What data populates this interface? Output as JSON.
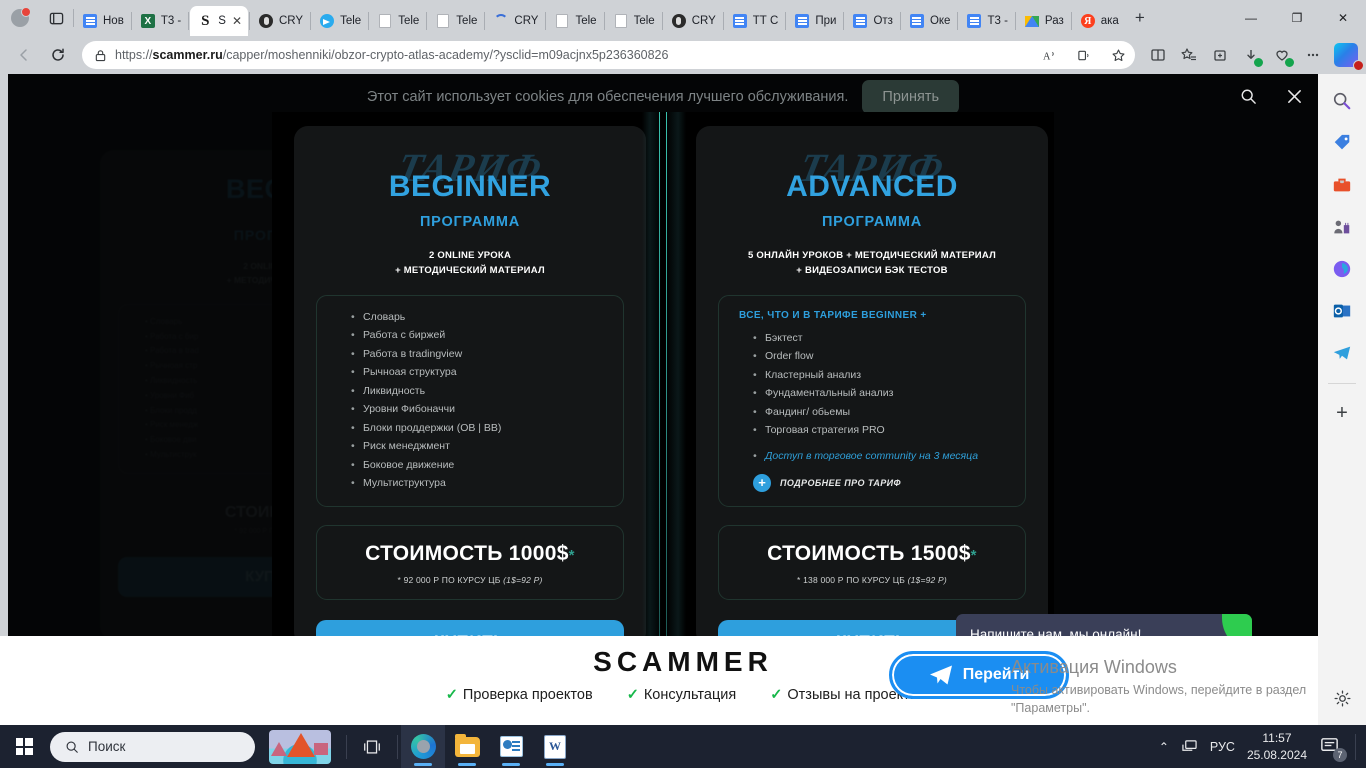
{
  "browser": {
    "tabs": [
      {
        "label": "Нов",
        "icon": "google-docs-icon",
        "active": false
      },
      {
        "label": "Т3 -",
        "icon": "excel-icon",
        "active": false
      },
      {
        "label": "S",
        "icon": "scammer-icon",
        "active": true
      },
      {
        "label": "CRY",
        "icon": "crypto-icon",
        "active": false
      },
      {
        "label": "Tele",
        "icon": "telegram-icon",
        "active": false
      },
      {
        "label": "Tele",
        "icon": "document-icon",
        "active": false
      },
      {
        "label": "Tele",
        "icon": "document-icon",
        "active": false
      },
      {
        "label": "CRY",
        "icon": "loading-spinner-icon",
        "active": false
      },
      {
        "label": "Tele",
        "icon": "document-icon",
        "active": false
      },
      {
        "label": "Tele",
        "icon": "document-icon",
        "active": false
      },
      {
        "label": "CRY",
        "icon": "crypto-icon",
        "active": false
      },
      {
        "label": "ТТ С",
        "icon": "google-docs-icon",
        "active": false
      },
      {
        "label": "При",
        "icon": "google-docs-icon",
        "active": false
      },
      {
        "label": "Отз",
        "icon": "google-docs-icon",
        "active": false
      },
      {
        "label": "Оке",
        "icon": "google-docs-icon",
        "active": false
      },
      {
        "label": "Т3 -",
        "icon": "google-docs-icon",
        "active": false
      },
      {
        "label": "Раз",
        "icon": "google-drive-icon",
        "active": false
      },
      {
        "label": "ака",
        "icon": "yandex-icon",
        "active": false
      }
    ],
    "new_tab_label": "+",
    "window_controls": {
      "minimize": "—",
      "maximize": "❐",
      "close": "✕"
    },
    "url_prefix": "https://",
    "url_host": "scammer.ru",
    "url_path": "/capper/moshenniki/obzor-crypto-atlas-academy/?ysclid=m09acjnx5p236360826"
  },
  "page": {
    "cookie_notice": "Этот сайт использует cookies для обеспечения лучшего обслуживания.",
    "cookie_accept": "Принять",
    "overlay_search_icon": "search-icon",
    "overlay_close_icon": "close-icon",
    "cards": [
      {
        "script_word": "ТАРИФ",
        "title": "BEGINNER",
        "program_label": "ПРОГРАММА",
        "desc_line1": "2 ONLINE УРОКА",
        "desc_line2": "+ МЕТОДИЧЕСКИЙ МАТЕРИАЛ",
        "features_head": "",
        "features": [
          "Словарь",
          "Работа с биржей",
          "Работа в tradingview",
          "Рычноая структура",
          "Ликвидность",
          "Уровни Фибоначчи",
          "Блоки проддержки (OB | BB)",
          "Риск менеджмент",
          "Боковое движение",
          "Мультиструктура"
        ],
        "accent_feature": "",
        "more_label": "",
        "price": "СТОИМОСТЬ 1000$",
        "price_asterisk": "*",
        "price_note": "* 92 000 Р ПО КУРСУ ЦБ ",
        "price_note_italic": "(1$=92 Р)",
        "buy_label": "КУПИТЬ"
      },
      {
        "script_word": "ТАРИФ",
        "title": "ADVANCED",
        "program_label": "ПРОГРАММА",
        "desc_line1": "5 ОНЛАЙН УРОКОВ + МЕТОДИЧЕСКИЙ МАТЕРИАЛ",
        "desc_line2": "+ ВИДЕОЗАПИСИ БЭК ТЕСТОВ",
        "features_head": "ВСЕ, ЧТО И В ТАРИФЕ BEGINNER +",
        "features": [
          "Бэктест",
          "Order flow",
          "Кластерный анализ",
          "Фундаментальный анализ",
          "Фандинг/ обьемы",
          "Торговая стратегия PRO"
        ],
        "accent_feature": "Доступ в торговое community на 3 месяца",
        "more_label": "ПОДРОБНЕЕ ПРО ТАРИФ",
        "price": "СТОИМОСТЬ 1500$",
        "price_asterisk": "*",
        "price_note": "* 138 000 Р ПО КУРСУ ЦБ ",
        "price_note_italic": "(1$=92 Р)",
        "buy_label": "КУПИТЬ"
      }
    ],
    "ghost_card": {
      "title": "BEGI",
      "program_label": "ПРОГР",
      "desc_line1": "2 ONLIN",
      "desc_line2": "+ МЕТОДИЧЕСК",
      "features": [
        "Словарь",
        "Работа с бир",
        "Работа в trad",
        "Рычноая стр",
        "Ликвидность",
        "Уровни Фиб",
        "Блоки продд",
        "Риск менедж",
        "Боковое дви",
        "Мультиструк"
      ],
      "price": "СТОИМО",
      "price_note": "* 92 000 Р ПО К",
      "buy_label": "КУП"
    },
    "chat_bubble": "Напишите нам, мы онлайн!"
  },
  "footer": {
    "brand": "SCAMMER",
    "checks": [
      "Проверка проектов",
      "Консультация",
      "Отзывы на проекты"
    ],
    "check_glyph": "✓",
    "cta_label": "Перейти",
    "cta_icon": "telegram-plane-icon"
  },
  "windows_activation": {
    "title": "Активация Windows",
    "subtitle": "Чтобы активировать Windows, перейдите в раздел \"Параметры\"."
  },
  "sidebar": {
    "items": [
      {
        "name": "search-icon"
      },
      {
        "name": "shopping-tag-icon"
      },
      {
        "name": "toolbox-icon"
      },
      {
        "name": "games-icon"
      },
      {
        "name": "office-icon"
      },
      {
        "name": "outlook-icon"
      },
      {
        "name": "telegram-icon"
      }
    ],
    "add_label": "+",
    "settings_icon": "gear-icon"
  },
  "taskbar": {
    "start_icon": "windows-start-icon",
    "search_placeholder": "Поиск",
    "widgets_icon": "weather-widget-icon",
    "taskview_icon": "task-view-icon",
    "apps": [
      {
        "name": "edge-icon",
        "running": true,
        "active": true
      },
      {
        "name": "file-explorer-icon",
        "running": true,
        "active": false
      },
      {
        "name": "powerpoint-icon",
        "running": true,
        "active": false
      },
      {
        "name": "word-icon",
        "running": true,
        "active": false
      }
    ],
    "tray": {
      "chevron": "⌃",
      "network_icon": "network-icon",
      "language": "РУС",
      "time": "11:57",
      "date": "25.08.2024",
      "notifications_icon": "notifications-icon",
      "notification_count": "7"
    }
  },
  "colors": {
    "accent_blue": "#2e9fdd",
    "card_bg": "#141617",
    "teal_border": "#20352f",
    "brand_black": "#111111",
    "check_green": "#17b84a",
    "cta_blue": "#1b8ef2"
  }
}
